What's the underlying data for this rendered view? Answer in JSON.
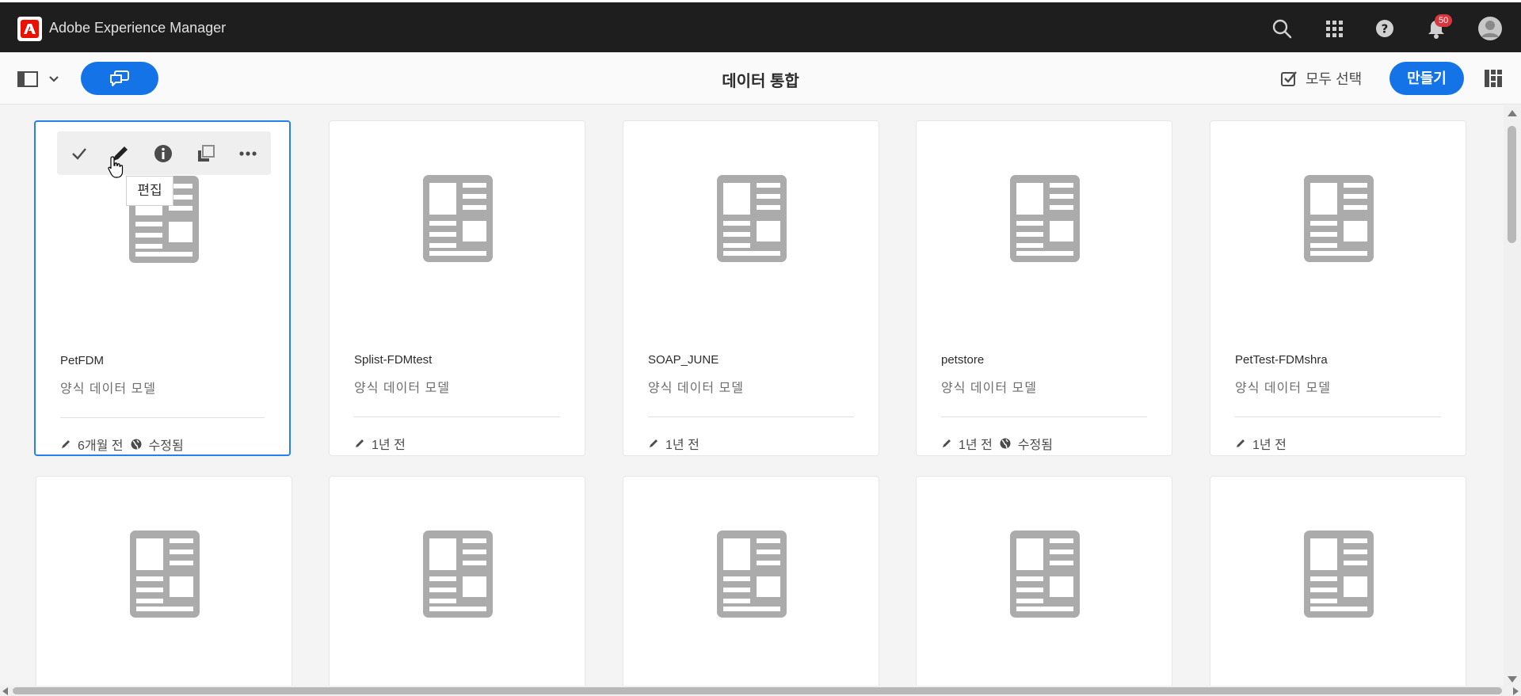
{
  "app": {
    "title": "Adobe Experience Manager",
    "notification_count": "50"
  },
  "page": {
    "title": "데이터 통합"
  },
  "toolbar": {
    "select_all_label": "모두 선택",
    "create_label": "만들기"
  },
  "quick_actions": {
    "tooltip": "편집"
  },
  "colors": {
    "accent": "#1473e6",
    "shell_bg": "#1e1e1e",
    "badge": "#d7373f",
    "selection": "#2680eb"
  },
  "cards": [
    {
      "name": "PetFDM",
      "type": "양식 데이터 모델",
      "modified": "6개월 전",
      "status": "수정됨",
      "selected": true
    },
    {
      "name": "Splist-FDMtest",
      "type": "양식 데이터 모델",
      "modified": "1년 전"
    },
    {
      "name": "SOAP_JUNE",
      "type": "양식 데이터 모델",
      "modified": "1년 전"
    },
    {
      "name": "petstore",
      "type": "양식 데이터 모델",
      "modified": "1년 전",
      "status": "수정됨"
    },
    {
      "name": "PetTest-FDMshra",
      "type": "양식 데이터 모델",
      "modified": "1년 전"
    }
  ]
}
